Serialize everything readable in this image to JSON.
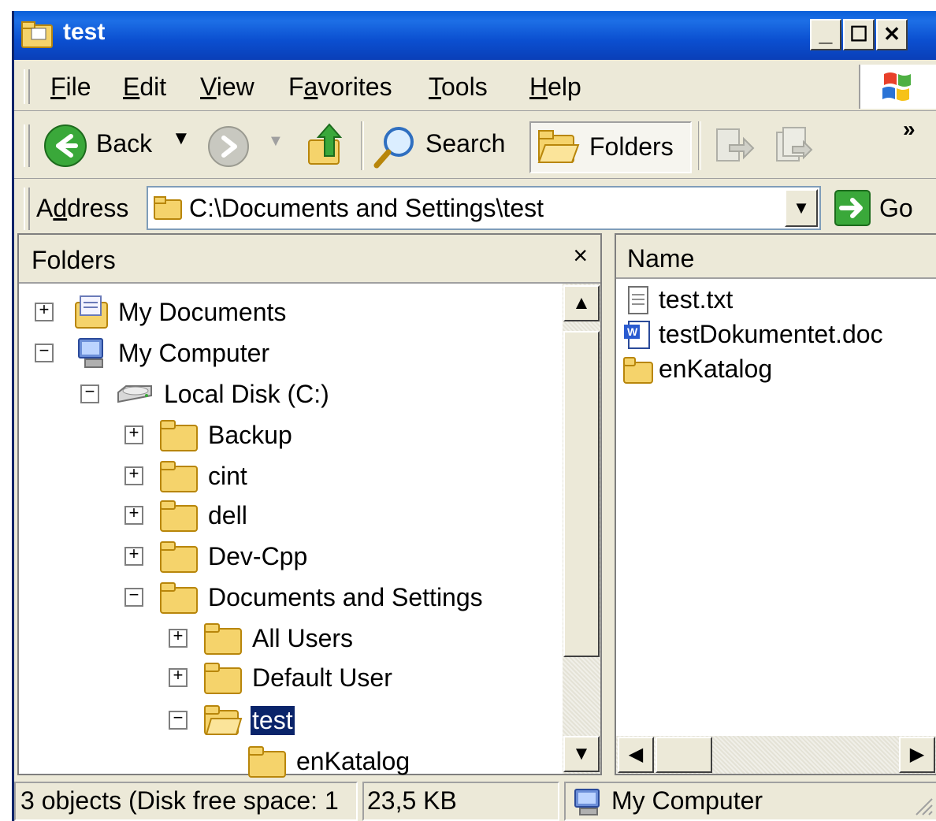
{
  "window": {
    "title": "test"
  },
  "title_buttons": {
    "minimize": "_",
    "maximize": "☐",
    "close": "✕"
  },
  "menu": {
    "items": [
      {
        "label": "File",
        "accel": "F",
        "rest": "ile"
      },
      {
        "label": "Edit",
        "accel": "E",
        "rest": "dit"
      },
      {
        "label": "View",
        "accel": "V",
        "rest": "iew"
      },
      {
        "label": "Favorites",
        "pre": "F",
        "accel": "a",
        "rest": "vorites"
      },
      {
        "label": "Tools",
        "accel": "T",
        "rest": "ools"
      },
      {
        "label": "Help",
        "accel": "H",
        "rest": "elp"
      }
    ]
  },
  "toolbar": {
    "back_label": "Back",
    "search_label": "Search",
    "folders_label": "Folders",
    "more": "»"
  },
  "address": {
    "label_pre": "A",
    "label_accel": "d",
    "label_rest": "dress",
    "value": "C:\\Documents and Settings\\test",
    "go_label": "Go"
  },
  "folders_pane": {
    "title": "Folders",
    "close": "×",
    "tree": [
      {
        "label": "My Documents",
        "expander": "+",
        "icon": "my-documents-icon"
      },
      {
        "label": "My Computer",
        "expander": "−",
        "icon": "my-computer-icon"
      },
      {
        "label": "Local Disk (C:)",
        "expander": "−",
        "icon": "disk-drive-icon"
      },
      {
        "label": "Backup",
        "expander": "+",
        "icon": "folder-icon"
      },
      {
        "label": "cint",
        "expander": "+",
        "icon": "folder-icon"
      },
      {
        "label": "dell",
        "expander": "+",
        "icon": "folder-icon"
      },
      {
        "label": "Dev-Cpp",
        "expander": "+",
        "icon": "folder-icon"
      },
      {
        "label": "Documents and Settings",
        "expander": "−",
        "icon": "folder-icon"
      },
      {
        "label": "All Users",
        "expander": "+",
        "icon": "folder-icon"
      },
      {
        "label": "Default User",
        "expander": "+",
        "icon": "folder-icon"
      },
      {
        "label": "test",
        "expander": "−",
        "icon": "folder-open-icon",
        "selected": true
      },
      {
        "label": "enKatalog",
        "expander": "",
        "icon": "folder-icon"
      }
    ]
  },
  "files_pane": {
    "column_name": "Name",
    "files": [
      {
        "name": "test.txt",
        "icon": "text-file-icon"
      },
      {
        "name": "testDokumentet.doc",
        "icon": "word-document-icon"
      },
      {
        "name": "enKatalog",
        "icon": "folder-icon"
      }
    ]
  },
  "status": {
    "objects": "3 objects (Disk free space: 1",
    "size": "23,5 KB",
    "location": "My Computer"
  },
  "colors": {
    "titlebar": "#0a4fd0",
    "chrome": "#ece9d8",
    "selection": "#0a246a",
    "folder_yellow": "#f5d36b"
  }
}
